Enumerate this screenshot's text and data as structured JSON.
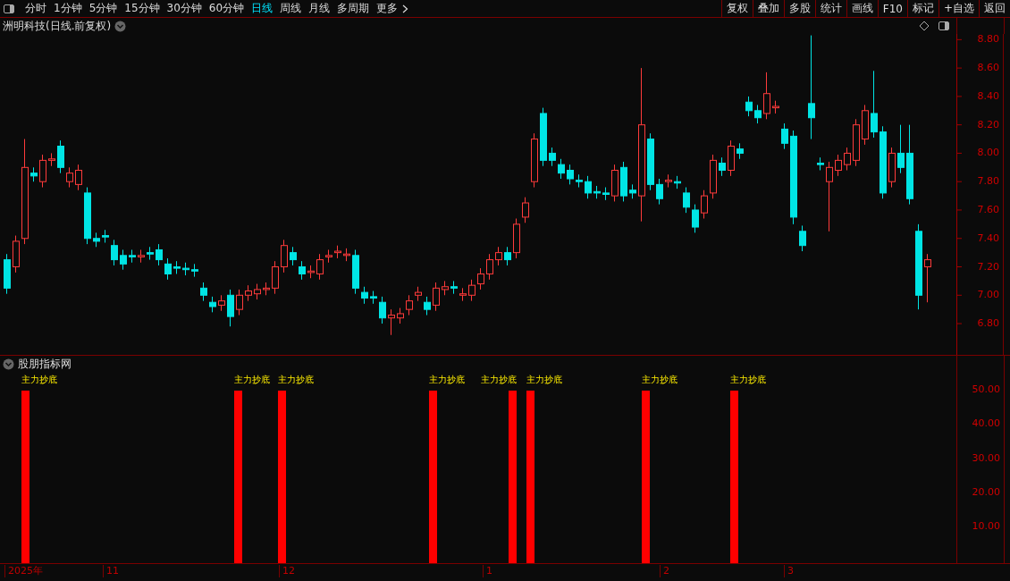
{
  "toolbar": {
    "periods": [
      {
        "label": "分时",
        "selected": false
      },
      {
        "label": "1分钟",
        "selected": false
      },
      {
        "label": "5分钟",
        "selected": false
      },
      {
        "label": "15分钟",
        "selected": false
      },
      {
        "label": "30分钟",
        "selected": false
      },
      {
        "label": "60分钟",
        "selected": false
      },
      {
        "label": "日线",
        "selected": true
      },
      {
        "label": "周线",
        "selected": false
      },
      {
        "label": "月线",
        "selected": false
      },
      {
        "label": "多周期",
        "selected": false
      }
    ],
    "more": "更多",
    "buttons": [
      "复权",
      "叠加",
      "多股",
      "统计",
      "画线",
      "F10",
      "标记",
      "+自选",
      "返回"
    ]
  },
  "main_chart": {
    "title": "洲明科技(日线.前复权)",
    "chart_data": {
      "type": "candlestick",
      "ylim": [
        6.58,
        8.84
      ],
      "yticks": [
        {
          "value": 8.8,
          "label": "8.80"
        },
        {
          "value": 8.6,
          "label": "8.60"
        },
        {
          "value": 8.4,
          "label": "8.40"
        },
        {
          "value": 8.2,
          "label": "8.20"
        },
        {
          "value": 8.0,
          "label": "8.00"
        },
        {
          "value": 7.8,
          "label": "7.80"
        },
        {
          "value": 7.6,
          "label": "7.60"
        },
        {
          "value": 7.4,
          "label": "7.40"
        },
        {
          "value": 7.2,
          "label": "7.20"
        },
        {
          "value": 7.0,
          "label": "7.00"
        },
        {
          "value": 6.8,
          "label": "6.80"
        }
      ],
      "ohlc": [
        [
          7.25,
          7.29,
          7.01,
          7.05
        ],
        [
          7.2,
          7.42,
          7.16,
          7.38
        ],
        [
          7.4,
          8.1,
          7.36,
          7.9
        ],
        [
          7.86,
          7.9,
          7.8,
          7.84
        ],
        [
          7.8,
          7.99,
          7.76,
          7.95
        ],
        [
          7.95,
          8.0,
          7.91,
          7.96
        ],
        [
          8.05,
          8.09,
          7.86,
          7.9
        ],
        [
          7.8,
          7.9,
          7.76,
          7.86
        ],
        [
          7.78,
          7.92,
          7.74,
          7.88
        ],
        [
          7.72,
          7.76,
          7.36,
          7.4
        ],
        [
          7.4,
          7.44,
          7.34,
          7.38
        ],
        [
          7.42,
          7.46,
          7.37,
          7.41
        ],
        [
          7.35,
          7.39,
          7.21,
          7.25
        ],
        [
          7.28,
          7.32,
          7.18,
          7.22
        ],
        [
          7.28,
          7.32,
          7.23,
          7.27
        ],
        [
          7.27,
          7.32,
          7.23,
          7.28
        ],
        [
          7.3,
          7.34,
          7.25,
          7.29
        ],
        [
          7.32,
          7.36,
          7.21,
          7.25
        ],
        [
          7.22,
          7.26,
          7.11,
          7.15
        ],
        [
          7.2,
          7.24,
          7.15,
          7.19
        ],
        [
          7.19,
          7.23,
          7.14,
          7.18
        ],
        [
          7.18,
          7.22,
          7.13,
          7.17
        ],
        [
          7.05,
          7.09,
          6.96,
          7.0
        ],
        [
          6.95,
          6.99,
          6.88,
          6.92
        ],
        [
          6.93,
          7.0,
          6.89,
          6.96
        ],
        [
          7.0,
          7.04,
          6.78,
          6.85
        ],
        [
          6.9,
          7.04,
          6.86,
          7.0
        ],
        [
          7.0,
          7.07,
          6.96,
          7.03
        ],
        [
          7.01,
          7.08,
          6.97,
          7.04
        ],
        [
          7.04,
          7.09,
          7.0,
          7.05
        ],
        [
          7.05,
          7.24,
          7.01,
          7.2
        ],
        [
          7.2,
          7.39,
          7.16,
          7.35
        ],
        [
          7.3,
          7.34,
          7.21,
          7.25
        ],
        [
          7.2,
          7.24,
          7.11,
          7.15
        ],
        [
          7.16,
          7.21,
          7.12,
          7.17
        ],
        [
          7.15,
          7.29,
          7.11,
          7.25
        ],
        [
          7.27,
          7.32,
          7.23,
          7.28
        ],
        [
          7.3,
          7.35,
          7.26,
          7.31
        ],
        [
          7.28,
          7.33,
          7.24,
          7.29
        ],
        [
          7.28,
          7.32,
          7.01,
          7.05
        ],
        [
          7.02,
          7.06,
          6.94,
          6.98
        ],
        [
          6.99,
          7.03,
          6.94,
          6.98
        ],
        [
          6.95,
          6.99,
          6.8,
          6.84
        ],
        [
          6.84,
          6.9,
          6.72,
          6.86
        ],
        [
          6.84,
          6.91,
          6.8,
          6.87
        ],
        [
          6.9,
          7.0,
          6.86,
          6.96
        ],
        [
          7.0,
          7.06,
          6.96,
          7.02
        ],
        [
          6.95,
          6.99,
          6.86,
          6.9
        ],
        [
          6.93,
          7.09,
          6.89,
          7.05
        ],
        [
          7.04,
          7.1,
          7.0,
          7.06
        ],
        [
          7.06,
          7.1,
          7.01,
          7.05
        ],
        [
          7.0,
          7.05,
          6.96,
          7.01
        ],
        [
          7.0,
          7.11,
          6.96,
          7.07
        ],
        [
          7.08,
          7.19,
          7.04,
          7.15
        ],
        [
          7.15,
          7.29,
          7.11,
          7.25
        ],
        [
          7.25,
          7.34,
          7.21,
          7.3
        ],
        [
          7.3,
          7.34,
          7.21,
          7.25
        ],
        [
          7.3,
          7.54,
          7.26,
          7.5
        ],
        [
          7.55,
          7.69,
          7.51,
          7.65
        ],
        [
          7.8,
          8.14,
          7.76,
          8.1
        ],
        [
          8.28,
          8.32,
          7.91,
          7.95
        ],
        [
          8.0,
          8.04,
          7.91,
          7.95
        ],
        [
          7.92,
          7.96,
          7.82,
          7.86
        ],
        [
          7.88,
          7.92,
          7.78,
          7.82
        ],
        [
          7.81,
          7.85,
          7.76,
          7.8
        ],
        [
          7.8,
          7.84,
          7.68,
          7.72
        ],
        [
          7.73,
          7.77,
          7.68,
          7.72
        ],
        [
          7.72,
          7.76,
          7.67,
          7.71
        ],
        [
          7.7,
          7.92,
          7.66,
          7.88
        ],
        [
          7.9,
          7.94,
          7.66,
          7.7
        ],
        [
          7.74,
          7.78,
          7.68,
          7.72
        ],
        [
          7.7,
          8.6,
          7.52,
          8.2
        ],
        [
          8.1,
          8.14,
          7.74,
          7.78
        ],
        [
          7.78,
          7.82,
          7.64,
          7.68
        ],
        [
          7.8,
          7.85,
          7.76,
          7.81
        ],
        [
          7.8,
          7.84,
          7.75,
          7.79
        ],
        [
          7.72,
          7.76,
          7.58,
          7.62
        ],
        [
          7.6,
          7.64,
          7.44,
          7.48
        ],
        [
          7.58,
          7.74,
          7.54,
          7.7
        ],
        [
          7.72,
          7.99,
          7.68,
          7.95
        ],
        [
          7.93,
          7.97,
          7.84,
          7.88
        ],
        [
          7.88,
          8.09,
          7.84,
          8.05
        ],
        [
          8.03,
          8.07,
          7.96,
          8.0
        ],
        [
          8.36,
          8.4,
          8.26,
          8.3
        ],
        [
          8.3,
          8.34,
          8.21,
          8.25
        ],
        [
          8.28,
          8.57,
          8.24,
          8.42
        ],
        [
          8.32,
          8.37,
          8.28,
          8.33
        ],
        [
          8.17,
          8.21,
          8.03,
          8.07
        ],
        [
          8.12,
          8.16,
          7.5,
          7.55
        ],
        [
          7.45,
          7.49,
          7.31,
          7.35
        ],
        [
          8.35,
          8.83,
          8.1,
          8.25
        ],
        [
          7.93,
          7.97,
          7.88,
          7.92
        ],
        [
          7.8,
          7.94,
          7.45,
          7.9
        ],
        [
          7.88,
          7.99,
          7.84,
          7.95
        ],
        [
          7.92,
          8.04,
          7.88,
          8.0
        ],
        [
          7.95,
          8.24,
          7.91,
          8.2
        ],
        [
          8.1,
          8.34,
          8.06,
          8.3
        ],
        [
          8.28,
          8.58,
          8.11,
          8.15
        ],
        [
          8.15,
          8.19,
          7.68,
          7.72
        ],
        [
          7.8,
          8.04,
          7.76,
          8.0
        ],
        [
          8.0,
          8.2,
          7.86,
          7.9
        ],
        [
          8.0,
          8.2,
          7.64,
          7.68
        ],
        [
          7.45,
          7.5,
          6.9,
          7.0
        ],
        [
          7.2,
          7.29,
          6.95,
          7.25
        ]
      ]
    }
  },
  "indicator": {
    "title": "股朋指标网",
    "signals": [
      {
        "label": "主力抄底"
      },
      {
        "label": "主力抄底"
      },
      {
        "label": "主力抄底"
      },
      {
        "label": "主力抄底"
      },
      {
        "label": "主力抄底"
      },
      {
        "label": "主力抄底"
      },
      {
        "label": "主力抄底"
      },
      {
        "label": "主力抄底"
      }
    ],
    "y_ticks": [
      "50.00",
      "40.00",
      "30.00",
      "20.00",
      "10.00"
    ]
  },
  "date_axis": [
    "2025年",
    "11",
    "12",
    "1",
    "2",
    "3"
  ]
}
